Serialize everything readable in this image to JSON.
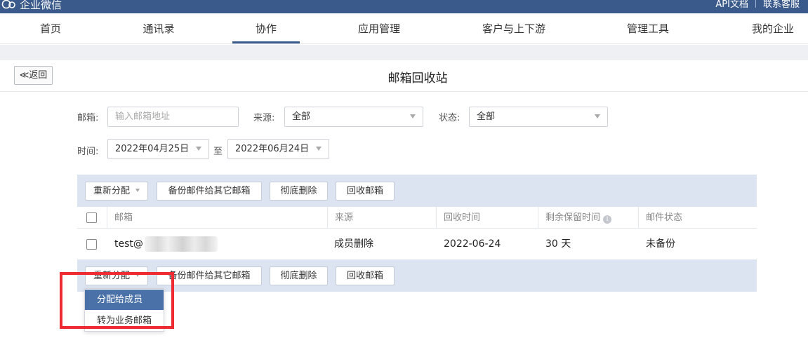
{
  "brand": {
    "name": "企业微信"
  },
  "top_links": [
    "API文档",
    "联系客服"
  ],
  "nav": {
    "items": [
      "首页",
      "通讯录",
      "协作",
      "应用管理",
      "客户与上下游",
      "管理工具",
      "我的企业"
    ],
    "active": "协作"
  },
  "header": {
    "back_label": "≪返回",
    "title": "邮箱回收站"
  },
  "filters": {
    "email_label": "邮箱:",
    "email_placeholder": "输入邮箱地址",
    "source_label": "来源:",
    "source_value": "全部",
    "status_label": "状态:",
    "status_value": "全部",
    "time_label": "时间:",
    "start_date": "2022年04月25日",
    "to_label": "至",
    "end_date": "2022年06月24日"
  },
  "toolbar": {
    "reassign": "重新分配",
    "backup": "备份邮件给其它邮箱",
    "delete": "彻底删除",
    "recover": "回收邮箱"
  },
  "table": {
    "columns": [
      "邮箱",
      "来源",
      "回收时间",
      "剩余保留时间",
      "邮件状态"
    ],
    "rows": [
      {
        "email": "test@",
        "source": "成员删除",
        "recycle_time": "2022-06-24",
        "remaining": "30 天",
        "status": "未备份"
      }
    ]
  },
  "dropdown": {
    "items": [
      "分配给成员",
      "转为业务邮箱"
    ],
    "highlighted": "分配给成员"
  },
  "colors": {
    "brand": "#3b5a8c",
    "toolbar_bg": "#dbe4f0",
    "highlight": "#4b72a8",
    "annotation": "#ee2a32"
  }
}
